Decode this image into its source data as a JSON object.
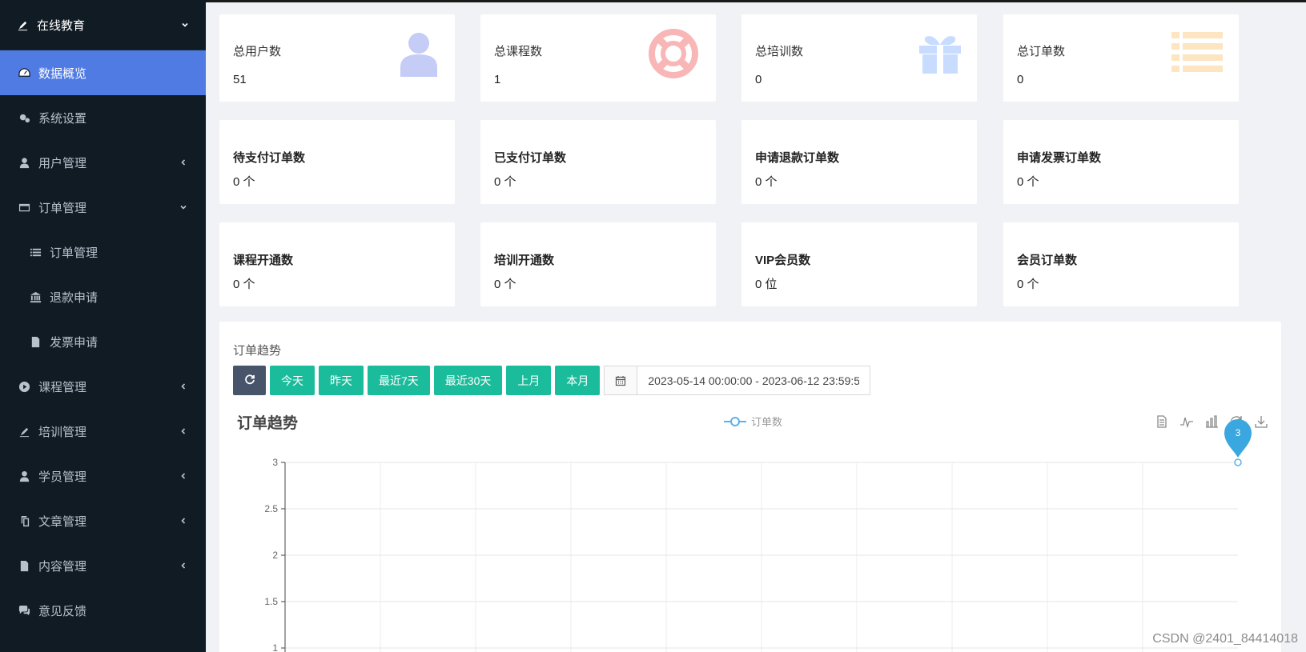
{
  "sidebar": {
    "brand": {
      "label": "在线教育",
      "icon": "pen-icon"
    },
    "items": [
      {
        "label": "数据概览",
        "icon": "dashboard-icon",
        "active": true,
        "caret": ""
      },
      {
        "label": "系统设置",
        "icon": "gears-icon",
        "caret": ""
      },
      {
        "label": "用户管理",
        "icon": "user-icon",
        "caret": "left"
      },
      {
        "label": "订单管理",
        "icon": "card-icon",
        "caret": "down"
      },
      {
        "label": "订单管理",
        "icon": "list-icon",
        "sub": true,
        "caret": ""
      },
      {
        "label": "退款申请",
        "icon": "bank-icon",
        "sub": true,
        "caret": ""
      },
      {
        "label": "发票申请",
        "icon": "file-icon",
        "sub": true,
        "caret": ""
      },
      {
        "label": "课程管理",
        "icon": "play-icon",
        "caret": "left"
      },
      {
        "label": "培训管理",
        "icon": "pen-icon",
        "caret": "left"
      },
      {
        "label": "学员管理",
        "icon": "user-tie-icon",
        "caret": "left"
      },
      {
        "label": "文章管理",
        "icon": "copy-icon",
        "caret": "left"
      },
      {
        "label": "内容管理",
        "icon": "file-icon",
        "caret": "left"
      },
      {
        "label": "意见反馈",
        "icon": "comments-icon",
        "caret": ""
      }
    ]
  },
  "stats_top": [
    {
      "title": "总用户数",
      "value": "51",
      "icon": "user-icon",
      "color": "#c5ccf5"
    },
    {
      "title": "总课程数",
      "value": "1",
      "icon": "lifebuoy-icon",
      "color": "#f9b6b6"
    },
    {
      "title": "总培训数",
      "value": "0",
      "icon": "gift-icon",
      "color": "#c7dcff"
    },
    {
      "title": "总订单数",
      "value": "0",
      "icon": "list-icon",
      "color": "#fde5c2"
    }
  ],
  "stats_mid": [
    {
      "title": "待支付订单数",
      "value": "0 个"
    },
    {
      "title": "已支付订单数",
      "value": "0 个"
    },
    {
      "title": "申请退款订单数",
      "value": "0 个"
    },
    {
      "title": "申请发票订单数",
      "value": "0 个"
    }
  ],
  "stats_bottom": [
    {
      "title": "课程开通数",
      "value": "0 个"
    },
    {
      "title": "培训开通数",
      "value": "0 个"
    },
    {
      "title": "VIP会员数",
      "value": "0 位"
    },
    {
      "title": "会员订单数",
      "value": "0 个"
    }
  ],
  "trend_panel": {
    "title": "订单趋势",
    "refresh_icon": "refresh-icon",
    "buttons": [
      "今天",
      "昨天",
      "最近7天",
      "最近30天",
      "上月",
      "本月"
    ],
    "calendar_icon": "calendar-icon",
    "date_range": "2023-05-14 00:00:00 - 2023-06-12 23:59:59"
  },
  "chart_data": {
    "type": "line",
    "title": "订单趋势",
    "series": [
      {
        "name": "订单数",
        "values": [
          3
        ]
      }
    ],
    "markpoint_label": "3",
    "yticks": [
      "3",
      "2.5",
      "2",
      "1.5",
      "1"
    ],
    "ylim": [
      1,
      3
    ],
    "grid": true,
    "legend_position": "top-center",
    "toolbox": [
      "data-view-icon",
      "line-icon",
      "bar-icon",
      "restore-icon",
      "download-icon"
    ],
    "line_color": "#5ab1ef",
    "marker_color": "#3aa7e0"
  },
  "watermark": "CSDN @2401_84414018"
}
